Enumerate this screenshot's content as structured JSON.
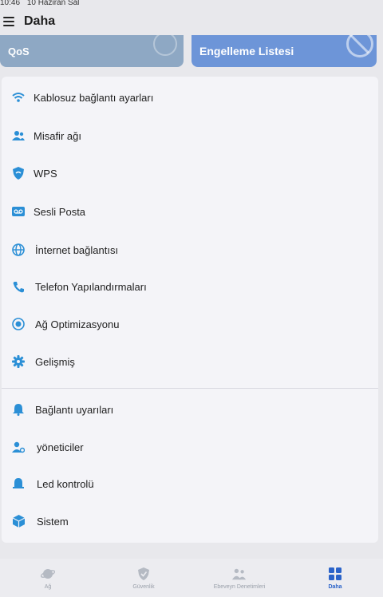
{
  "status_bar": {
    "time": "10:46",
    "date": "10 Haziran Sal"
  },
  "header": {
    "title": "Daha"
  },
  "cards": {
    "qos": {
      "label": "QoS"
    },
    "block_list": {
      "label": "Engelleme Listesi"
    }
  },
  "menu": {
    "items": [
      {
        "label": "Kablosuz bağlantı ayarları",
        "icon": "wifi-icon"
      },
      {
        "label": "Misafir ağı",
        "icon": "guest-users-icon"
      },
      {
        "label": "WPS",
        "icon": "wps-shield-icon"
      },
      {
        "label": "Sesli Posta",
        "icon": "voicemail-icon"
      },
      {
        "label": "İnternet bağlantısı",
        "icon": "globe-icon"
      },
      {
        "label": "Telefon Yapılandırmaları",
        "icon": "phone-icon"
      },
      {
        "label": "Ağ Optimizasyonu",
        "icon": "optimization-icon"
      },
      {
        "label": "Gelişmiş",
        "icon": "gear-icon"
      },
      {
        "label": "Bağlantı uyarıları",
        "icon": "bell-icon"
      },
      {
        "label": "yöneticiler",
        "icon": "admin-user-icon"
      },
      {
        "label": "Led kontrolü",
        "icon": "led-icon"
      },
      {
        "label": "Sistem",
        "icon": "system-cube-icon"
      }
    ]
  },
  "bottom_nav": {
    "items": [
      {
        "label": "Ağ",
        "icon": "planet-icon",
        "active": false
      },
      {
        "label": "Güvenlik",
        "icon": "security-shield-icon",
        "active": false
      },
      {
        "label": "Ebeveyn Denetimleri",
        "icon": "parental-icon",
        "active": false
      },
      {
        "label": "Daha",
        "icon": "grid-icon",
        "active": true
      }
    ]
  },
  "colors": {
    "accent": "#2b8fd6",
    "active_nav": "#2b63c9",
    "card_block": "#6d95d8",
    "card_qos": "#8ea8c4"
  }
}
